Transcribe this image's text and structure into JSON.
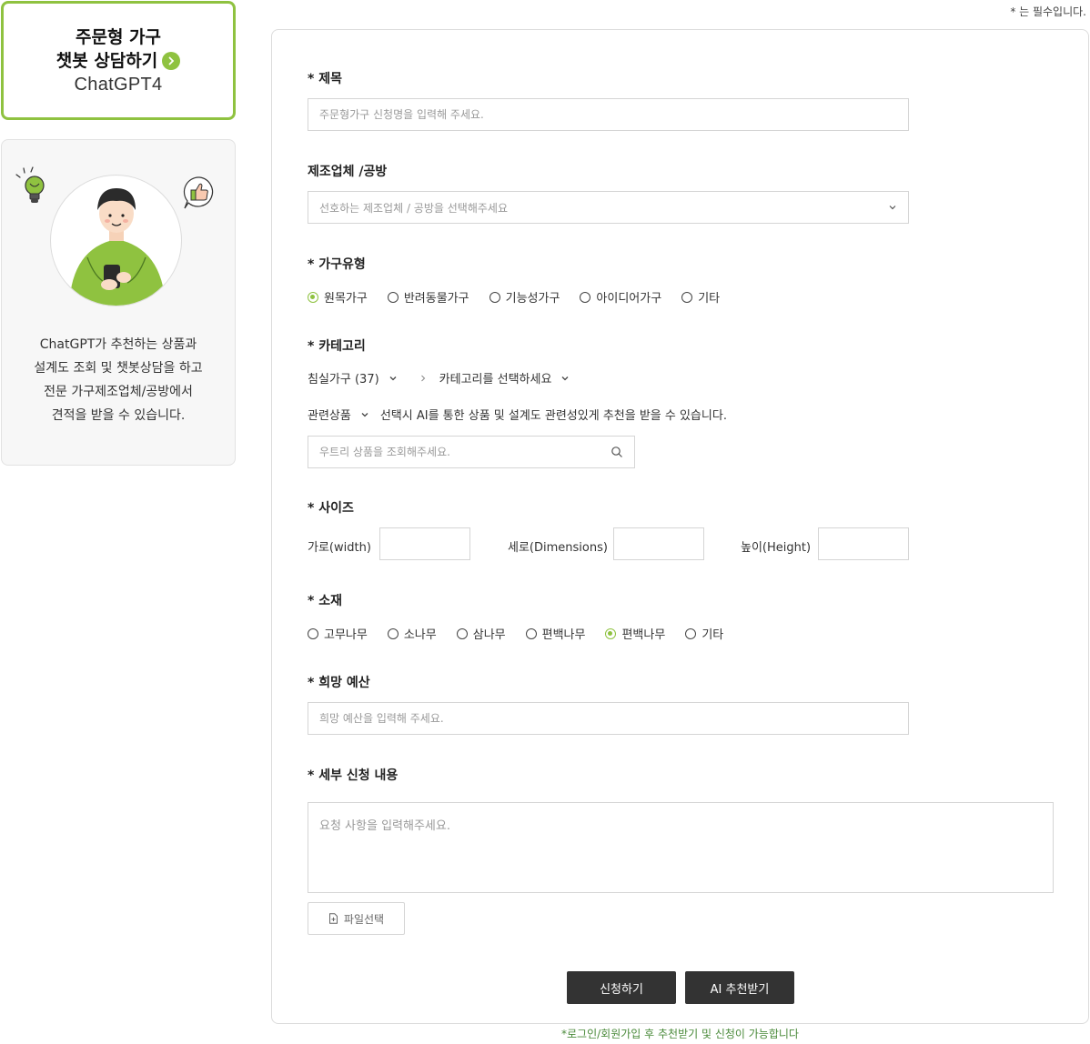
{
  "sidebar": {
    "chat_title_line1": "주문형 가구",
    "chat_title_line2": "챗봇 상담하기",
    "chat_model": "ChatGPT4",
    "intro_lines": [
      "ChatGPT가 추천하는 상품과",
      "설계도 조회 및 챗봇상담을 하고",
      "전문 가구제조업체/공방에서",
      "견적을 받을 수 있습니다."
    ]
  },
  "required_note": "* 는 필수입니다.",
  "form": {
    "title_label": "* 제목",
    "title_placeholder": "주문형가구 신청명을 입력해 주세요.",
    "maker_label": "제조업체 /공방",
    "maker_placeholder": "선호하는 제조업체 / 공방을 선택해주세요",
    "type_label": "* 가구유형",
    "type_options": [
      "원목가구",
      "반려동물가구",
      "기능성가구",
      "아이디어가구",
      "기타"
    ],
    "type_selected_index": 0,
    "category_label": "* 카테고리",
    "category_primary": "침실가구 (37)",
    "category_secondary": "카테고리를 선택하세요",
    "related_label": "관련상품",
    "related_hint": "선택시 AI를 통한 상품 및 설계도 관련성있게 추천을 받을 수 있습니다.",
    "search_placeholder": "우트리 상품을 조회해주세요.",
    "size_label": "* 사이즈",
    "size_width": "가로(width)",
    "size_dimensions": "세로(Dimensions)",
    "size_height": "높이(Height)",
    "material_label": "* 소재",
    "material_options": [
      "고무나무",
      "소나무",
      "삼나무",
      "편백나무",
      "편백나무",
      "기타"
    ],
    "material_selected_index": 4,
    "budget_label": "* 희망 예산",
    "budget_placeholder": "희망 예산을 입력해 주세요.",
    "detail_label": "* 세부 신청 내용",
    "detail_placeholder": "요청 사항을 입력해주세요.",
    "file_button": "파일선택",
    "submit_button": "신청하기",
    "ai_button": "AI 추천받기"
  },
  "login_note": "*로그인/회원가입 후 추천받기 및 신청이 가능합니다",
  "colors": {
    "accent": "#8fc240",
    "dark_button": "#333333",
    "note_green": "#4a8a3a"
  }
}
